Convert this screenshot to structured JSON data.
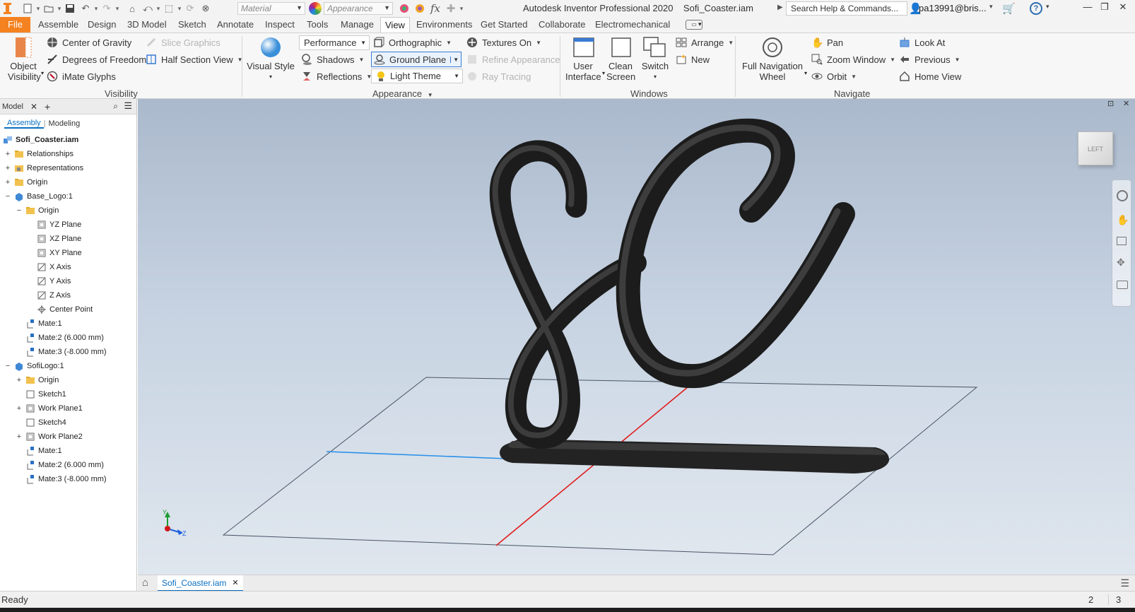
{
  "title_bar": {
    "material_placeholder": "Material",
    "appearance_placeholder": "Appearance",
    "app_title": "Autodesk Inventor Professional 2020",
    "doc_name": "Sofi_Coaster.iam",
    "search_text": "Search Help & Commands...",
    "user": "pa13991@bris...",
    "icons": [
      "new-icon",
      "open-icon",
      "save-icon",
      "undo-icon",
      "redo-icon",
      "home-icon",
      "return-icon",
      "update-icon",
      "select-icon",
      "color-override-icon",
      "fx-icon",
      "plus-icon"
    ]
  },
  "ribbon_tabs": [
    "File",
    "Assemble",
    "Design",
    "3D Model",
    "Sketch",
    "Annotate",
    "Inspect",
    "Tools",
    "Manage",
    "View",
    "Environments",
    "Get Started",
    "Collaborate",
    "Electromechanical"
  ],
  "active_tab": "View",
  "ribbon": {
    "visibility": {
      "object_visibility": "Object Visibility",
      "center_of_gravity": "Center of Gravity",
      "degrees_of_freedom": "Degrees of Freedom",
      "imate_glyphs": "iMate Glyphs",
      "slice_graphics": "Slice Graphics",
      "half_section_view": "Half Section View",
      "label": "Visibility"
    },
    "appearance": {
      "visual_style": "Visual Style",
      "performance": "Performance",
      "shadows": "Shadows",
      "reflections": "Reflections",
      "orthographic": "Orthographic",
      "ground_plane": "Ground Plane",
      "light_theme": "Light Theme",
      "textures_on": "Textures On",
      "refine_appearance": "Refine Appearance",
      "ray_tracing": "Ray Tracing",
      "label": "Appearance"
    },
    "windows": {
      "user_interface": "User Interface",
      "clean_screen": "Clean Screen",
      "switch": "Switch",
      "arrange": "Arrange",
      "new": "New",
      "label": "Windows"
    },
    "navigate": {
      "full_navigation_wheel": "Full Navigation Wheel",
      "pan": "Pan",
      "zoom_window": "Zoom Window",
      "orbit": "Orbit",
      "look_at": "Look At",
      "previous": "Previous",
      "home_view": "Home View",
      "label": "Navigate"
    }
  },
  "browser": {
    "header": "Model",
    "tabs": [
      "Assembly",
      "Modeling"
    ],
    "active_tab": "Assembly",
    "root": "Sofi_Coaster.iam",
    "items": [
      {
        "label": "Relationships",
        "icon": "folder-icon",
        "expander": "+"
      },
      {
        "label": "Representations",
        "icon": "representations-icon",
        "expander": "+"
      },
      {
        "label": "Origin",
        "icon": "folder-icon",
        "expander": "+"
      },
      {
        "label": "Base_Logo:1",
        "icon": "part-icon",
        "expander": "−"
      },
      {
        "label": "Origin",
        "icon": "folder-icon",
        "expander": "−"
      },
      {
        "label": "YZ Plane",
        "icon": "plane-icon",
        "expander": ""
      },
      {
        "label": "XZ Plane",
        "icon": "plane-icon",
        "expander": ""
      },
      {
        "label": "XY Plane",
        "icon": "plane-icon",
        "expander": ""
      },
      {
        "label": "X Axis",
        "icon": "axis-icon",
        "expander": ""
      },
      {
        "label": "Y Axis",
        "icon": "axis-icon",
        "expander": ""
      },
      {
        "label": "Z Axis",
        "icon": "axis-icon",
        "expander": ""
      },
      {
        "label": "Center Point",
        "icon": "point-icon",
        "expander": ""
      },
      {
        "label": "Mate:1",
        "icon": "mate-icon",
        "expander": ""
      },
      {
        "label": "Mate:2 (6.000 mm)",
        "icon": "mate-icon",
        "expander": ""
      },
      {
        "label": "Mate:3 (-8.000 mm)",
        "icon": "mate-icon",
        "expander": ""
      },
      {
        "label": "SofiLogo:1",
        "icon": "part-icon",
        "expander": "−"
      },
      {
        "label": "Origin",
        "icon": "folder-icon",
        "expander": "+"
      },
      {
        "label": "Sketch1",
        "icon": "sketch-icon",
        "expander": ""
      },
      {
        "label": "Work Plane1",
        "icon": "plane-icon",
        "expander": "+"
      },
      {
        "label": "Sketch4",
        "icon": "sketch-icon",
        "expander": ""
      },
      {
        "label": "Work Plane2",
        "icon": "plane-icon",
        "expander": "+"
      },
      {
        "label": "Mate:1",
        "icon": "mate-icon",
        "expander": ""
      },
      {
        "label": "Mate:2 (6.000 mm)",
        "icon": "mate-icon",
        "expander": ""
      },
      {
        "label": "Mate:3 (-8.000 mm)",
        "icon": "mate-icon",
        "expander": ""
      }
    ]
  },
  "viewcube_label": "LEFT",
  "doc_tab": "Sofi_Coaster.iam",
  "status": {
    "text": "Ready",
    "count_a": "2",
    "count_b": "3"
  },
  "colors": {
    "file_tab": "#f58220",
    "accent_blue": "#0a6fc2",
    "model_dark": "#2a2a2a",
    "axis_red": "#e01b1b",
    "axis_blue": "#1e88e5"
  }
}
